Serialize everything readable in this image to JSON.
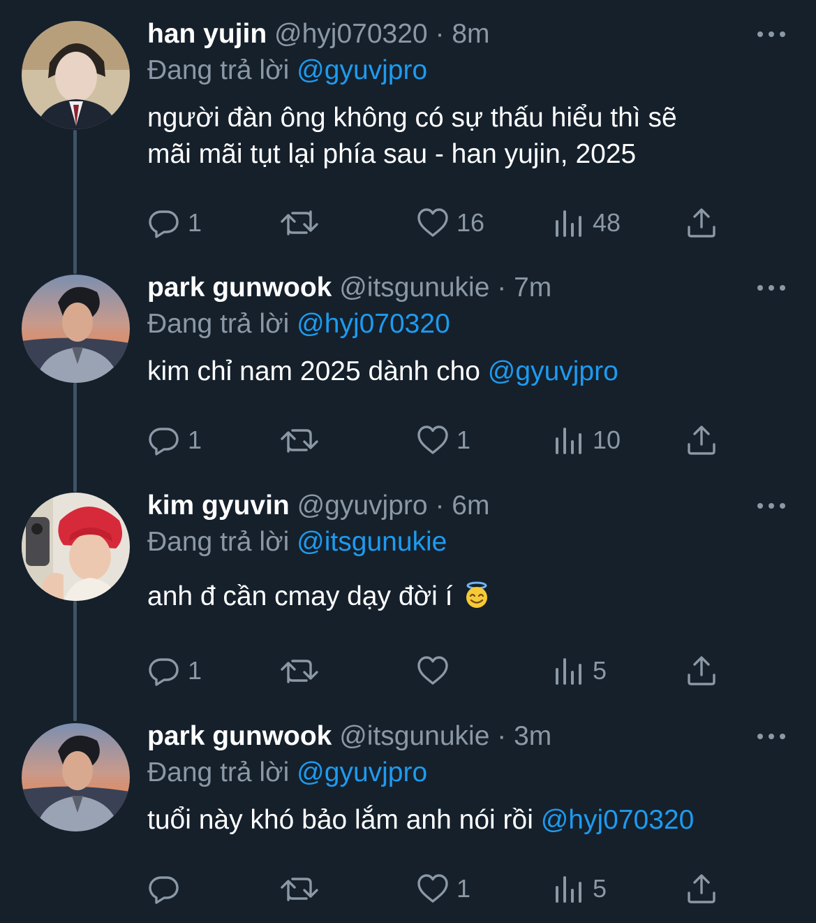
{
  "tweets": [
    {
      "name": "han yujin",
      "handle": "@hyj070320",
      "dot": "·",
      "time": "8m",
      "replying_prefix": "Đang trả lời",
      "replying_to": "@gyuvjpro",
      "text_line1": "người đàn ông không có sự thấu hiểu thì sẽ",
      "text_line2": "mãi mãi tụt lại phía sau - han yujin, 2025",
      "reply_count": "1",
      "retweet_count": "",
      "like_count": "16",
      "view_count": "48"
    },
    {
      "name": "park gunwook",
      "handle": "@itsgunukie",
      "dot": "·",
      "time": "7m",
      "replying_prefix": "Đang trả lời",
      "replying_to": "@hyj070320",
      "text_plain": "kim chỉ nam 2025 dành cho ",
      "text_mention": "@gyuvjpro",
      "reply_count": "1",
      "retweet_count": "",
      "like_count": "1",
      "view_count": "10"
    },
    {
      "name": "kim gyuvin",
      "handle": "@gyuvjpro",
      "dot": "·",
      "time": "6m",
      "replying_prefix": "Đang trả lời",
      "replying_to": "@itsgunukie",
      "text_plain": "anh đ cần cmay dạy đời í",
      "emoji": "smiling-face-with-halo",
      "reply_count": "1",
      "retweet_count": "",
      "like_count": "",
      "view_count": "5"
    },
    {
      "name": "park gunwook",
      "handle": "@itsgunukie",
      "dot": "·",
      "time": "3m",
      "replying_prefix": "Đang trả lời",
      "replying_to": "@gyuvjpro",
      "text_plain": "tuổi này khó bảo lắm anh nói rồi ",
      "text_mention": "@hyj070320",
      "reply_count": "",
      "retweet_count": "",
      "like_count": "1",
      "view_count": "5"
    }
  ],
  "colors": {
    "background": "#15202b",
    "text": "#ffffff",
    "secondary": "#8b98a5",
    "mention": "#1d9bf0",
    "thread_line": "#3d5466"
  },
  "icons": [
    "reply-icon",
    "retweet-icon",
    "like-icon",
    "views-icon",
    "share-icon",
    "more-icon"
  ]
}
